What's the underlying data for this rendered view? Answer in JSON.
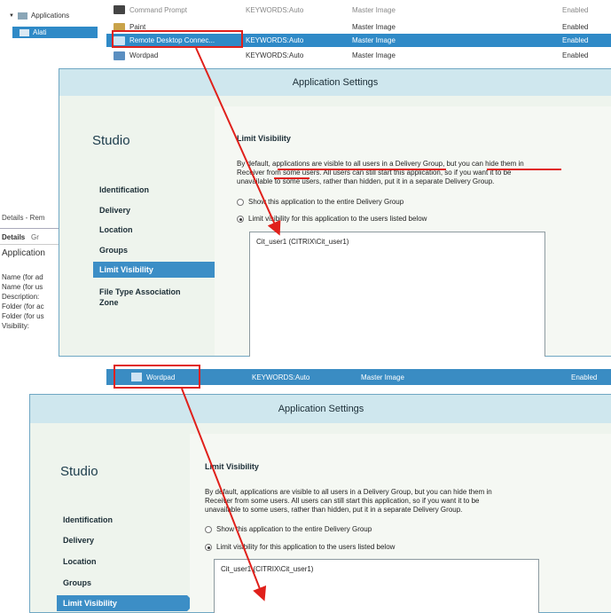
{
  "tree": {
    "applications_label": "Applications",
    "alati_label": "Alati",
    "truncated_top": "Command Prompt"
  },
  "app_rows": [
    {
      "name": "Command Prompt",
      "keywords": "KEYWORDS:Auto",
      "group": "Master Image",
      "state": "Enabled"
    },
    {
      "name": "Paint",
      "keywords": "",
      "group": "Master Image",
      "state": "Enabled"
    },
    {
      "name": "Remote Desktop Connec...",
      "keywords": "KEYWORDS:Auto",
      "group": "Master Image",
      "state": "Enabled"
    },
    {
      "name": "Wordpad",
      "keywords": "KEYWORDS:Auto",
      "group": "Master Image",
      "state": "Enabled"
    }
  ],
  "details": {
    "title": "Details - Rem",
    "tab_details": "Details",
    "tab_other": "Gr",
    "section": "Application",
    "fields": [
      "Name (for ad",
      "Name (for us",
      "Description:",
      "Folder (for ac",
      "Folder (for us",
      "Visibility:"
    ]
  },
  "dialog1": {
    "title": "Application Settings",
    "studio": "Studio",
    "nav": [
      "Identification",
      "Delivery",
      "Location",
      "Groups",
      "Limit Visibility",
      "File Type Association",
      "Zone"
    ],
    "active_nav": "Limit Visibility",
    "heading": "Limit Visibility",
    "paragraph_l1": "By default, applications are visible to all users in a Delivery Group, but you can hide them in",
    "paragraph_l2": "Receiver from some users. All users can still start this application, so if you want it to be",
    "paragraph_l3": "unavailable to some users, rather than hidden, put it in a separate Delivery Group.",
    "option_show": "Show this application to the entire Delivery Group",
    "option_limit": "Limit visibility for this application to the users listed below",
    "user": "Cit_user1 (CITRIX\\Cit_user1)"
  },
  "bottom_row": {
    "name": "Wordpad",
    "keywords": "KEYWORDS:Auto",
    "group": "Master Image",
    "state": "Enabled"
  },
  "dialog2": {
    "title": "Application Settings",
    "studio": "Studio",
    "nav": [
      "Identification",
      "Delivery",
      "Location",
      "Groups",
      "Limit Visibility"
    ],
    "heading": "Limit Visibility",
    "paragraph_l1": "By default, applications are visible to all users in a Delivery Group, but you can hide them in",
    "paragraph_l2": "Receiver from some users. All users can still start this application, so if you want it to be",
    "paragraph_l3": "unavailable to some users, rather than hidden, put it in a separate Delivery Group.",
    "option_show": "Show this application to the entire Delivery Group",
    "option_limit": "Limit visibility for this application to the users listed below",
    "user": "Cit_user1 (CITRIX\\Cit_user1)"
  },
  "colors": {
    "selection": "#2f8ac7",
    "annotation": "#e0201b",
    "dialog_bg": "#eef4ed",
    "dialog_title": "#cfe7ee"
  }
}
